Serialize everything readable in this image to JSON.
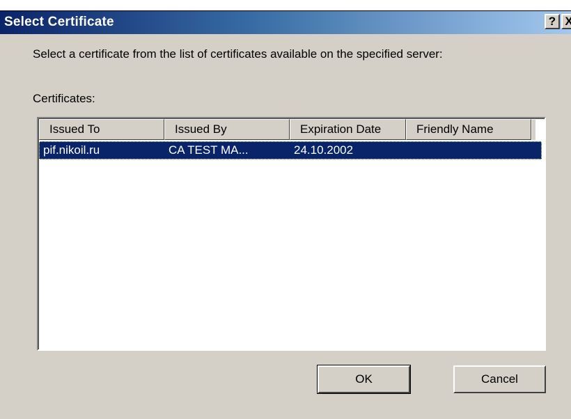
{
  "dialog": {
    "title": "Select Certificate",
    "help_button": "?",
    "close_button": "X",
    "prompt": "Select a certificate from the list of certificates available on the specified server:",
    "certificates_label": "Certificates:"
  },
  "list": {
    "columns": [
      "Issued To",
      "Issued By",
      "Expiration Date",
      "Friendly Name"
    ],
    "rows": [
      {
        "issued_to": "pif.nikoil.ru",
        "issued_by": "CA TEST MA...",
        "expiration_date": "24.10.2002",
        "friendly_name": "",
        "selected": true
      }
    ]
  },
  "buttons": {
    "ok": "OK",
    "cancel": "Cancel"
  },
  "colors": {
    "dialog_face": "#d4d0c8",
    "title_gradient_start": "#0a246a",
    "title_gradient_end": "#a6caf0",
    "selection": "#0a246a"
  }
}
